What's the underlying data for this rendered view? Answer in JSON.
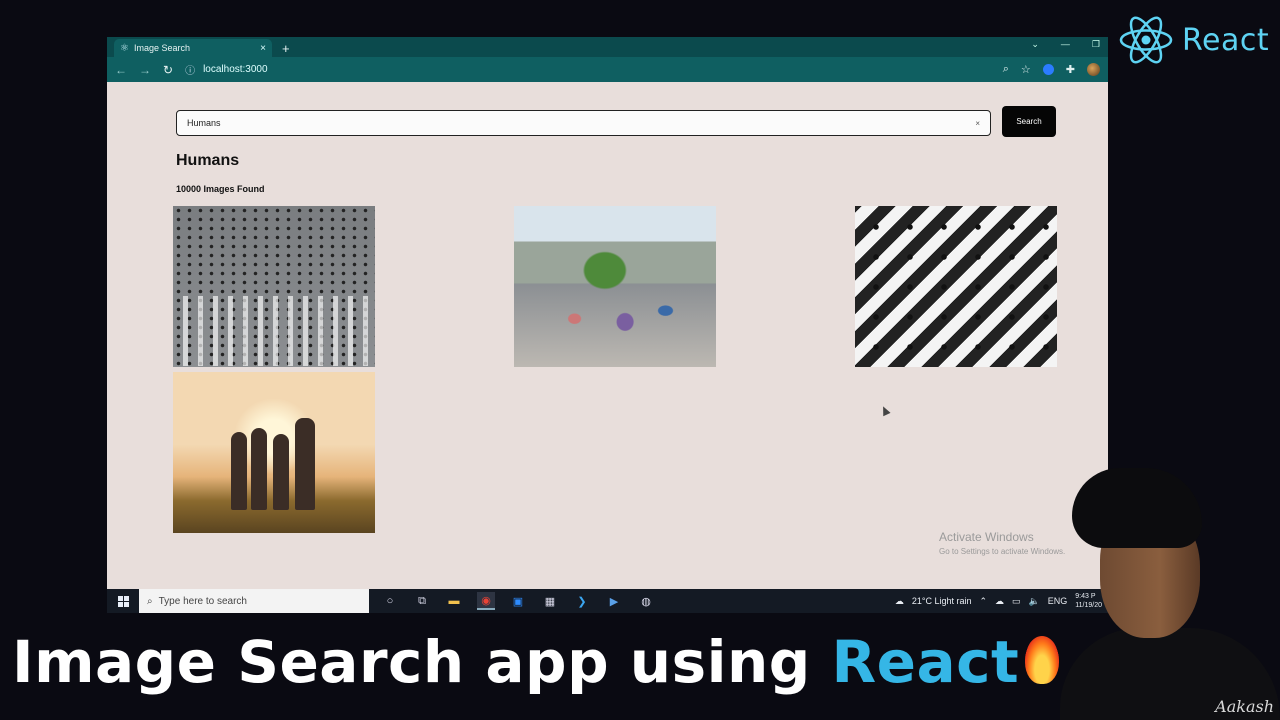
{
  "branding": {
    "logo_text": "React",
    "accent_color": "#35b6e6"
  },
  "browser": {
    "tab_title": "Image Search",
    "new_tab_glyph": "+",
    "close_glyph": "×",
    "url": "localhost:3000"
  },
  "app": {
    "search_value": "Humans",
    "clear_glyph": "×",
    "search_button_label": "Search",
    "results_title": "Humans",
    "results_count": "10000 Images Found",
    "images": [
      {
        "icon": "crowd-crosswalk-aerial-image"
      },
      {
        "icon": "city-street-crowd-image"
      },
      {
        "icon": "zebra-crossing-pedestrians-image"
      },
      {
        "icon": "friends-sunset-image"
      }
    ]
  },
  "watermark": {
    "line1": "Activate Windows",
    "line2": "Go to Settings to activate Windows."
  },
  "taskbar": {
    "search_placeholder": "Type here to search",
    "weather": "21°C  Light rain",
    "language": "ENG",
    "time": "9:43 P",
    "date": "11/19/20"
  },
  "headline": {
    "main": "Image Search app using ",
    "highlight": "React"
  },
  "presenter": {
    "signature": "Aakash"
  }
}
